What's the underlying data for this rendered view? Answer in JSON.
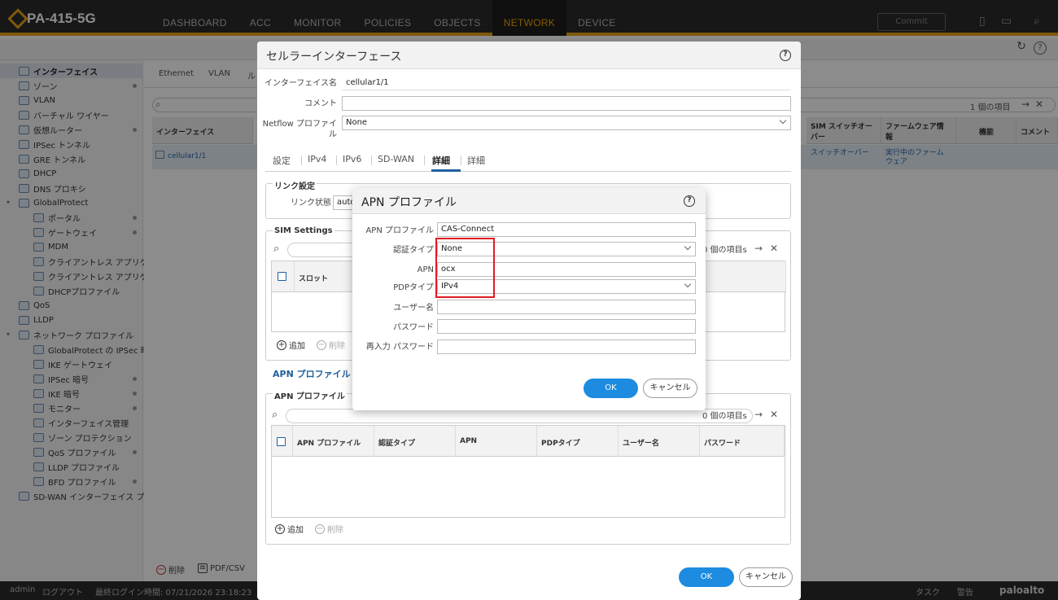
{
  "app": {
    "device_name": "PA-415-5G"
  },
  "nav": {
    "tabs": [
      "DASHBOARD",
      "ACC",
      "MONITOR",
      "POLICIES",
      "OBJECTS",
      "NETWORK",
      "DEVICE"
    ],
    "active": "NETWORK",
    "commit_label": "Commit"
  },
  "sidebar": {
    "items": [
      {
        "label": "インターフェイス",
        "level": 1,
        "selected": true
      },
      {
        "label": "ゾーン",
        "level": 1,
        "dot": true
      },
      {
        "label": "VLAN",
        "level": 1
      },
      {
        "label": "バーチャル ワイヤー",
        "level": 1
      },
      {
        "label": "仮想ルーター",
        "level": 1,
        "dot": true
      },
      {
        "label": "IPSec トンネル",
        "level": 1
      },
      {
        "label": "GRE トンネル",
        "level": 1
      },
      {
        "label": "DHCP",
        "level": 1
      },
      {
        "label": "DNS プロキシ",
        "level": 1
      },
      {
        "label": "GlobalProtect",
        "level": 1,
        "expand": true
      },
      {
        "label": "ポータル",
        "level": 2,
        "dot": true
      },
      {
        "label": "ゲートウェイ",
        "level": 2,
        "dot": true
      },
      {
        "label": "MDM",
        "level": 2
      },
      {
        "label": "クライアントレス アプリケ",
        "level": 2
      },
      {
        "label": "クライアントレス アプリケ",
        "level": 2
      },
      {
        "label": "DHCPプロファイル",
        "level": 2
      },
      {
        "label": "QoS",
        "level": 1
      },
      {
        "label": "LLDP",
        "level": 1
      },
      {
        "label": "ネットワーク プロファイル",
        "level": 1,
        "expand": true
      },
      {
        "label": "GlobalProtect の IPSec 暗号",
        "level": 2
      },
      {
        "label": "IKE ゲートウェイ",
        "level": 2
      },
      {
        "label": "IPSec 暗号",
        "level": 2,
        "dot": true
      },
      {
        "label": "IKE 暗号",
        "level": 2,
        "dot": true
      },
      {
        "label": "モニター",
        "level": 2,
        "dot": true
      },
      {
        "label": "インターフェイス管理",
        "level": 2
      },
      {
        "label": "ゾーン プロテクション",
        "level": 2
      },
      {
        "label": "QoS プロファイル",
        "level": 2,
        "dot": true
      },
      {
        "label": "LLDP プロファイル",
        "level": 2
      },
      {
        "label": "BFD プロファイル",
        "level": 2,
        "dot": true
      },
      {
        "label": "SD-WAN インターフェイス プ",
        "level": 1
      }
    ]
  },
  "content": {
    "tabs": [
      "Ethernet",
      "VLAN",
      "ル"
    ],
    "count": "1 個の項目",
    "columns": {
      "interface": "インターフェイス",
      "sim_switch": "SIM スイッチオー\nバー",
      "firmware": "ファームウェア情\n報",
      "function": "機能",
      "comment": "コメント"
    },
    "row": {
      "interface": "cellular1/1",
      "sim_switch": "スイッチオーバー",
      "firmware": "実行中のファーム\nウェア"
    },
    "delete_label": "削除",
    "pdf_label": "PDF/CSV"
  },
  "status": {
    "user": "admin",
    "logout": "ログアウト",
    "last_login": "最終ログイン時間: 07/21/2026 23:18:23",
    "tasks": "タスク",
    "alerts": "警告",
    "brand": "paloalto"
  },
  "cellular_dialog": {
    "title": "セルラーインターフェース",
    "fields": {
      "interface_name_label": "インターフェイス名",
      "interface_name": "cellular1/1",
      "comment_label": "コメント",
      "comment": "",
      "netflow_label": "Netflow プロファイ\nル",
      "netflow": "None"
    },
    "tabs": [
      "設定",
      "IPv4",
      "IPv6",
      "SD-WAN",
      "詳細",
      "詳細"
    ],
    "active_tab": "詳細",
    "link": {
      "title": "リンク設定",
      "state_label": "リンク状態",
      "state_value": "auto"
    },
    "sim": {
      "title": "SIM Settings",
      "count": "0 個の項目s",
      "slot_col": "スロット",
      "add": "追加",
      "delete": "削除"
    },
    "apn_link": "APN プロファイル",
    "apn_group": {
      "title": "APN プロファイル",
      "count": "0 個の項目s",
      "columns": [
        "APN プロファイル",
        "認証タイプ",
        "APN",
        "PDPタイプ",
        "ユーザー名",
        "パスワード"
      ],
      "add": "追加",
      "delete": "削除"
    },
    "ok": "OK",
    "cancel": "キャンセル"
  },
  "apn_dialog": {
    "title": "APN プロファイル",
    "fields": [
      {
        "label": "APN プロファイル",
        "value": "CAS-Connect",
        "type": "text"
      },
      {
        "label": "認証タイプ",
        "value": "None",
        "type": "select"
      },
      {
        "label": "APN",
        "value": "ocx",
        "type": "text"
      },
      {
        "label": "PDPタイプ",
        "value": "IPv4",
        "type": "select"
      },
      {
        "label": "ユーザー名",
        "value": "",
        "type": "text"
      },
      {
        "label": "パスワード",
        "value": "",
        "type": "text"
      },
      {
        "label": "再入力 パスワード",
        "value": "",
        "type": "text"
      }
    ],
    "ok": "OK",
    "cancel": "キャンセル"
  },
  "colors": {
    "accent": "#e8a317",
    "primary_button": "#1c8be0",
    "highlight_box": "#e01b22",
    "link": "#1f5f9e"
  }
}
